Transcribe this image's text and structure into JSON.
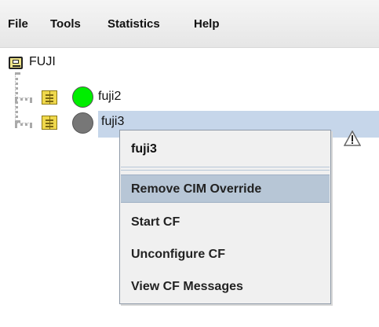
{
  "menubar": {
    "items": [
      {
        "label": "File"
      },
      {
        "label": "Tools"
      },
      {
        "label": "Statistics"
      },
      {
        "label": "Help"
      }
    ]
  },
  "tree": {
    "root": {
      "label": "FUJI",
      "icon": "cluster-icon"
    },
    "nodes": [
      {
        "label": "fuji2",
        "status_color": "#00ee00",
        "icon": "node-icon"
      },
      {
        "label": "fuji3",
        "status_color": "#777777",
        "icon": "node-icon",
        "selected": true,
        "warning": true
      }
    ]
  },
  "context_menu": {
    "title": "fuji3",
    "items": [
      {
        "label": "Remove CIM Override",
        "active": true
      },
      {
        "label": "Start CF"
      },
      {
        "label": "Unconfigure CF"
      },
      {
        "label": "View CF Messages"
      }
    ]
  },
  "colors": {
    "selection": "#c6d6ea",
    "menu_active": "#b7c6d6",
    "menu_background": "#f0f0f0"
  }
}
